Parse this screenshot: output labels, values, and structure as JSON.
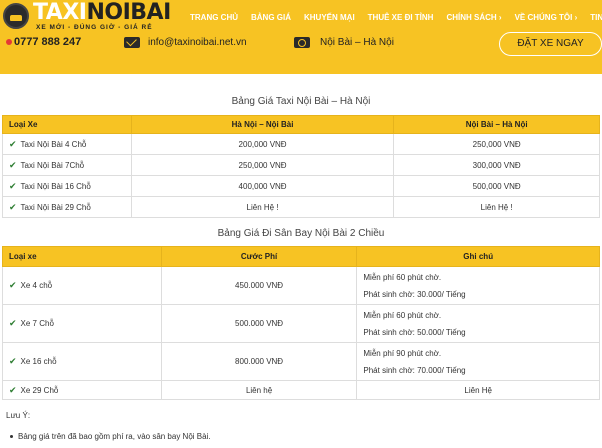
{
  "header": {
    "logo_part1": "TAXI",
    "logo_part2": "NOIBAI",
    "tagline": "XE MỚI - ĐÚNG GIỜ - GIÁ RẺ",
    "nav": [
      "TRANG CHỦ",
      "BẢNG GIÁ",
      "KHUYẾN MẠI",
      "THUÊ XE ĐI TỈNH",
      "CHÍNH SÁCH ›",
      "VỀ CHÚNG TÔI ›",
      "TIN TỨC"
    ],
    "phone": "0777 888 247",
    "email": "info@taxinoibai.net.vn",
    "location": "Nội Bài – Hà Nội",
    "book_button": "ĐẶT XE NGAY"
  },
  "table1": {
    "title": "Bảng Giá Taxi Nội Bài – Hà Nội",
    "headers": [
      "Loại Xe",
      "Hà Nội – Nội Bài",
      "Nội Bài – Hà Nội"
    ],
    "rows": [
      [
        "Taxi Nội Bài 4 Chỗ",
        "200,000 VNĐ",
        "250,000 VNĐ"
      ],
      [
        "Taxi Nội Bài 7Chỗ",
        "250,000 VNĐ",
        "300,000 VNĐ"
      ],
      [
        "Taxi Nội Bài 16 Chỗ",
        "400,000 VNĐ",
        "500,000 VNĐ"
      ],
      [
        "Taxi Nội Bài 29 Chỗ",
        "Liên Hệ !",
        "Liên Hệ !"
      ]
    ]
  },
  "table2": {
    "title": "Bảng Giá Đi Sân Bay Nội Bài 2 Chiều",
    "headers": [
      "Loại xe",
      "Cước Phí",
      "Ghi chú"
    ],
    "rows": [
      [
        "Xe 4 chỗ",
        "450.000 VNĐ",
        "Miễn phí 60 phút chờ.",
        "Phát sinh chờ: 30.000/ Tiếng"
      ],
      [
        "Xe 7 Chỗ",
        "500.000 VNĐ",
        "Miễn phí 60 phút chờ.",
        "Phát sinh chờ: 50.000/ Tiếng"
      ],
      [
        "Xe 16 chỗ",
        "800.000 VNĐ",
        "Miễn phí 90 phút chờ.",
        "Phát sinh chờ: 70.000/ Tiếng"
      ],
      [
        "Xe 29 Chỗ",
        "Liên hệ",
        "Liên Hệ",
        ""
      ]
    ]
  },
  "note": {
    "title": "Lưu Ý:",
    "item": "Bảng giá trên đã bao gồm phí ra, vào sân bay Nội Bài."
  },
  "colors": {
    "brand": "#f7c323",
    "check": "#2e7d32"
  }
}
